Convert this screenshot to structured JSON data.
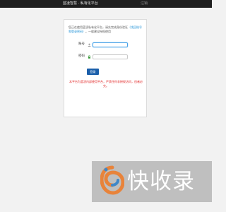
{
  "header": {
    "title": "蓝凌智慧 · 私有化平台",
    "right_link": "注销"
  },
  "login": {
    "intro_prefix": "您正在使用蓝凌私有化平台，请先完成身份验证",
    "intro_link": "（找回账号和登录密码）",
    "intro_suffix": "。一般建议授权使用",
    "account_label": "账号",
    "account_value": "",
    "password_label": "密码",
    "password_value": "",
    "submit_label": "登录",
    "warning": "本平台为蓝凌内部使用平台，严禁任何非授权访问，违者必究。"
  },
  "watermark": {
    "text": "快收录"
  },
  "colors": {
    "topbar": "#1f1f1f",
    "accent": "#1b5faa",
    "link": "#1a8fd6",
    "warning": "#e02020",
    "focus": "#4aa3e8"
  },
  "icons": [
    "user-icon",
    "lock-icon",
    "watermark-logo-icon"
  ]
}
